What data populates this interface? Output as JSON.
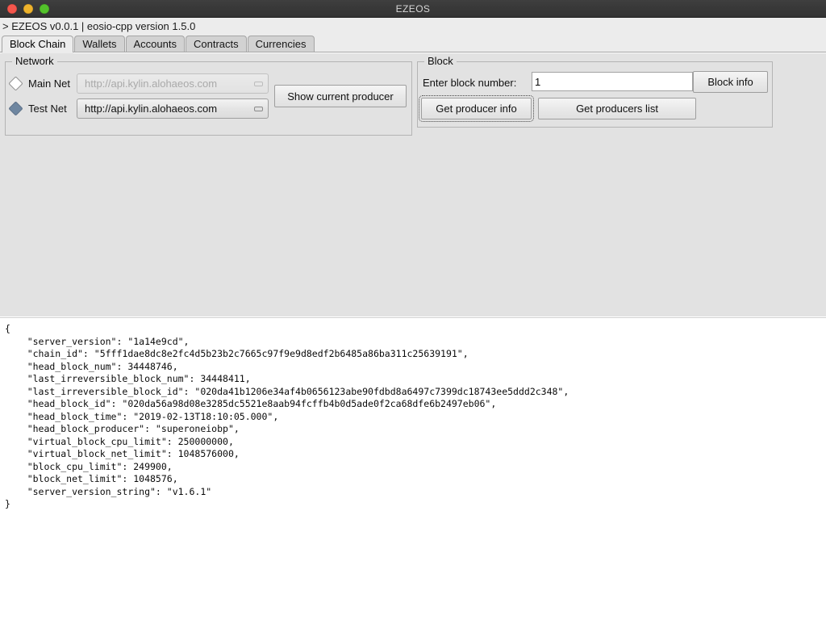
{
  "window": {
    "title": "EZEOS",
    "controls": [
      "close-button",
      "minimize-button",
      "maximize-button"
    ]
  },
  "status_line": "> EZEOS v0.0.1 | eosio-cpp version 1.5.0",
  "tabs": [
    {
      "label": "Block Chain",
      "active": true
    },
    {
      "label": "Wallets",
      "active": false
    },
    {
      "label": "Accounts",
      "active": false
    },
    {
      "label": "Contracts",
      "active": false
    },
    {
      "label": "Currencies",
      "active": false
    }
  ],
  "network": {
    "title": "Network",
    "main_net": {
      "label": "Main Net",
      "selected": false,
      "endpoint": "http://api.kylin.alohaeos.com",
      "enabled": false
    },
    "test_net": {
      "label": "Test Net",
      "selected": true,
      "endpoint": "http://api.kylin.alohaeos.com",
      "enabled": true
    },
    "show_current_producer_label": "Show current producer"
  },
  "block": {
    "title": "Block",
    "block_number_label": "Enter block number:",
    "block_number_value": "1",
    "block_number_placeholder": "",
    "block_info_label": "Block info",
    "get_producer_info_label": "Get producer info",
    "get_producers_list_label": "Get producers list"
  },
  "colors": {
    "titlebar": "#383838",
    "panel": "#e2e2e2",
    "tab_active": "#ececec",
    "tab_inactive": "#d2d2d2",
    "radio_checked": "#6e86a0",
    "output_bg": "#ffffff",
    "close_dot": "#f5564c",
    "min_dot": "#eeb32c",
    "max_dot": "#53c22b"
  },
  "output": {
    "text": "{\n    \"server_version\": \"1a14e9cd\",\n    \"chain_id\": \"5fff1dae8dc8e2fc4d5b23b2c7665c97f9e9d8edf2b6485a86ba311c25639191\",\n    \"head_block_num\": 34448746,\n    \"last_irreversible_block_num\": 34448411,\n    \"last_irreversible_block_id\": \"020da41b1206e34af4b0656123abe90fdbd8a6497c7399dc18743ee5ddd2c348\",\n    \"head_block_id\": \"020da56a98d08e3285dc5521e8aab94fcffb4b0d5ade0f2ca68dfe6b2497eb06\",\n    \"head_block_time\": \"2019-02-13T18:10:05.000\",\n    \"head_block_producer\": \"superoneiobp\",\n    \"virtual_block_cpu_limit\": 250000000,\n    \"virtual_block_net_limit\": 1048576000,\n    \"block_cpu_limit\": 249900,\n    \"block_net_limit\": 1048576,\n    \"server_version_string\": \"v1.6.1\"\n}",
    "fields": {
      "server_version": "1a14e9cd",
      "chain_id": "5fff1dae8dc8e2fc4d5b23b2c7665c97f9e9d8edf2b6485a86ba311c25639191",
      "head_block_num": 34448746,
      "last_irreversible_block_num": 34448411,
      "last_irreversible_block_id": "020da41b1206e34af4b0656123abe90fdbd8a6497c7399dc18743ee5ddd2c348",
      "head_block_id": "020da56a98d08e3285dc5521e8aab94fcffb4b0d5ade0f2ca68dfe6b2497eb06",
      "head_block_time": "2019-02-13T18:10:05.000",
      "head_block_producer": "superoneiobp",
      "virtual_block_cpu_limit": 250000000,
      "virtual_block_net_limit": 1048576000,
      "block_cpu_limit": 249900,
      "block_net_limit": 1048576,
      "server_version_string": "v1.6.1"
    }
  }
}
